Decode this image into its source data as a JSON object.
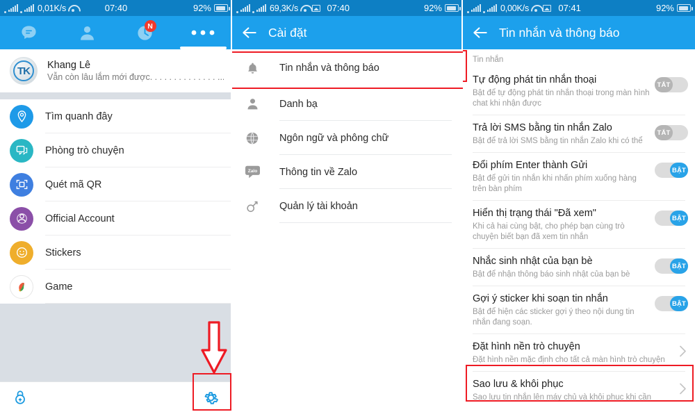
{
  "status_bars": [
    {
      "rate": "0,01K/s",
      "time": "07:40",
      "battery": "92%",
      "has_image_icon": false
    },
    {
      "rate": "69,3K/s",
      "time": "07:40",
      "battery": "92%",
      "has_image_icon": true
    },
    {
      "rate": "0,00K/s",
      "time": "07:41",
      "battery": "92%",
      "has_image_icon": true
    }
  ],
  "colors": {
    "header_blue": "#1ca0ec",
    "statusbar_blue": "#0d7fc4",
    "annotation_red": "#ee1b24",
    "toggle_on": "#29a3e8",
    "toggle_off": "#b5b5b5",
    "gray_section": "#d9dee4"
  },
  "panel1": {
    "tabs": [
      {
        "icon": "chat-bubble-icon",
        "label": "Tin nhắn",
        "selected": false,
        "badge": null
      },
      {
        "icon": "contacts-person-icon",
        "label": "Danh bạ",
        "selected": false,
        "badge": null
      },
      {
        "icon": "clock-timeline-icon",
        "label": "Nhật ký",
        "selected": false,
        "badge": "N"
      },
      {
        "icon": "more-dots-icon",
        "label": "Thêm",
        "selected": true,
        "badge": null
      }
    ],
    "profile": {
      "avatar_initials": "TK",
      "name": "Khang Lê",
      "status": "Vẫn còn lâu lắm mới được. . . . . . . . . . . . . . ..."
    },
    "menu": [
      {
        "label": "Tìm quanh đây",
        "icon": "location-pin-icon",
        "color": "#1e9ae8"
      },
      {
        "label": "Phòng trò chuyện",
        "icon": "chat-room-icon",
        "color": "#2ab7c4"
      },
      {
        "label": "Quét mã QR",
        "icon": "qr-scan-icon",
        "color": "#3f7fe0"
      },
      {
        "label": "Official Account",
        "icon": "official-account-icon",
        "color": "#8b4fa8"
      },
      {
        "label": "Stickers",
        "icon": "sticker-smiley-icon",
        "color": "#efae2c"
      },
      {
        "label": "Game",
        "icon": "game-icon",
        "color": "#ffffff"
      }
    ],
    "bottombar": {
      "lock_icon": "lock-icon",
      "settings_icon": "gear-icon"
    }
  },
  "panel2": {
    "back_icon": "back-arrow-icon",
    "title": "Cài đặt",
    "items": [
      {
        "label": "Tin nhắn và thông báo",
        "icon": "bell-icon",
        "highlighted": true
      },
      {
        "label": "Danh bạ",
        "icon": "person-icon",
        "highlighted": false
      },
      {
        "label": "Ngôn ngữ và phông chữ",
        "icon": "globe-icon",
        "highlighted": false
      },
      {
        "label": "Thông tin về Zalo",
        "icon": "zalo-logo-icon",
        "highlighted": false
      },
      {
        "label": "Quản lý tài khoản",
        "icon": "key-icon",
        "highlighted": false
      }
    ]
  },
  "panel3": {
    "back_icon": "back-arrow-icon",
    "title": "Tin nhắn và thông báo",
    "section_title": "Tin nhắn",
    "settings": [
      {
        "title": "Tự động phát tin nhắn thoại",
        "desc": "Bật để tự động phát tin nhắn thoại trong màn hình chat khi nhận được",
        "control": "toggle",
        "state": "off",
        "state_label": "TẮT",
        "highlighted": false
      },
      {
        "title": "Trả lời SMS bằng tin nhắn Zalo",
        "desc": "Bật để trả lời SMS bằng tin nhắn Zalo khi có thể",
        "control": "toggle",
        "state": "off",
        "state_label": "TẮT",
        "highlighted": false
      },
      {
        "title": "Đổi phím Enter thành Gửi",
        "desc": "Bật để gửi tin nhắn khi nhấn phím xuống hàng trên bàn phím",
        "control": "toggle",
        "state": "on",
        "state_label": "BẬT",
        "highlighted": false
      },
      {
        "title": "Hiển thị trạng thái \"Đã xem\"",
        "desc": "Khi cả hai cùng bật, cho phép bạn cùng trò chuyện biết bạn đã xem tin nhắn",
        "control": "toggle",
        "state": "on",
        "state_label": "BẬT",
        "highlighted": false
      },
      {
        "title": "Nhắc sinh nhật của bạn bè",
        "desc": "Bật để nhận thông báo sinh nhật của bạn bè",
        "control": "toggle",
        "state": "on",
        "state_label": "BẬT",
        "highlighted": false
      },
      {
        "title": "Gợi ý sticker khi soạn tin nhắn",
        "desc": "Bật để hiện các sticker gợi ý theo nội dung tin nhắn đang soạn.",
        "control": "toggle",
        "state": "on",
        "state_label": "BẬT",
        "highlighted": false
      },
      {
        "title": "Đặt hình nền trò chuyện",
        "desc": "Đặt hình nền mặc định cho tất cả màn hình trò chuyện",
        "control": "chevron",
        "state": null,
        "state_label": "",
        "highlighted": false
      },
      {
        "title": "Sao lưu & khôi phục",
        "desc": "Sao lưu tin nhắn lên máy chủ và khôi phục khi cần",
        "control": "chevron",
        "state": null,
        "state_label": "",
        "highlighted": true
      }
    ]
  }
}
